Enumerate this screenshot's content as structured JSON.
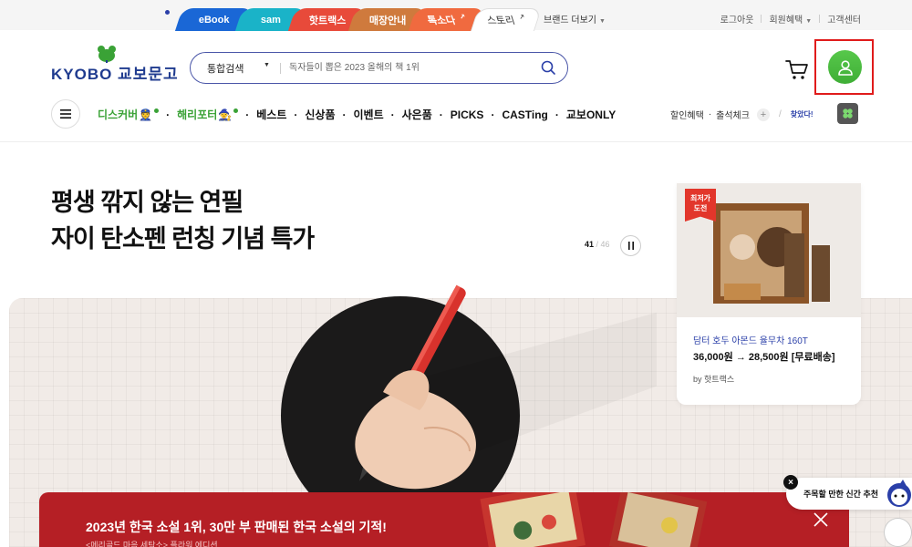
{
  "top_bar": {
    "service_tabs": [
      {
        "label": "eBook"
      },
      {
        "label": "sam"
      },
      {
        "label": "핫트랙스"
      },
      {
        "label": "매장안내"
      },
      {
        "label": "톡소다"
      },
      {
        "label": "스토리"
      }
    ],
    "brand_more": "브랜드 더보기",
    "util_links": [
      "로그아웃",
      "회원혜택",
      "고객센터"
    ]
  },
  "header": {
    "logo_text": "KYOBO 교보문고",
    "search": {
      "category": "통합검색",
      "placeholder": "독자들이 뽑은 2023 올해의 책 1위"
    }
  },
  "nav": {
    "items": [
      "디스커버",
      "해리포터",
      "베스트",
      "신상품",
      "이벤트",
      "사은품",
      "PICKS",
      "CASTing",
      "교보ONLY"
    ],
    "right": {
      "discount": "할인혜택",
      "attendance": "출석체크",
      "found": "찾았다!"
    }
  },
  "hero": {
    "title_line1": "평생 깎지 않는 연필",
    "title_line2": "자이 탄소펜 런칭 기념 특가",
    "pager_current": "41",
    "pager_total": "46"
  },
  "product_card": {
    "badge_line1": "최저가",
    "badge_line2": "도전",
    "name": "담터 호두 아몬드 율무차 160T",
    "price": "36,000원 → 28,500원 [무료배송]",
    "by": "by 핫트랙스"
  },
  "banner": {
    "title": "2023년 한국 소설 1위, 30만 부 판매된 한국 소설의 기적!",
    "subtitle": "<메리골드 마음 세탁소> 플라워 에디션"
  },
  "floating": {
    "recommendation": "주목할 만한 신간 추천"
  },
  "colors": {
    "brand_navy": "#1f3b8f",
    "brand_green": "#3aa236",
    "banner_red": "#b51f25",
    "highlight_red": "#e01b1b"
  }
}
